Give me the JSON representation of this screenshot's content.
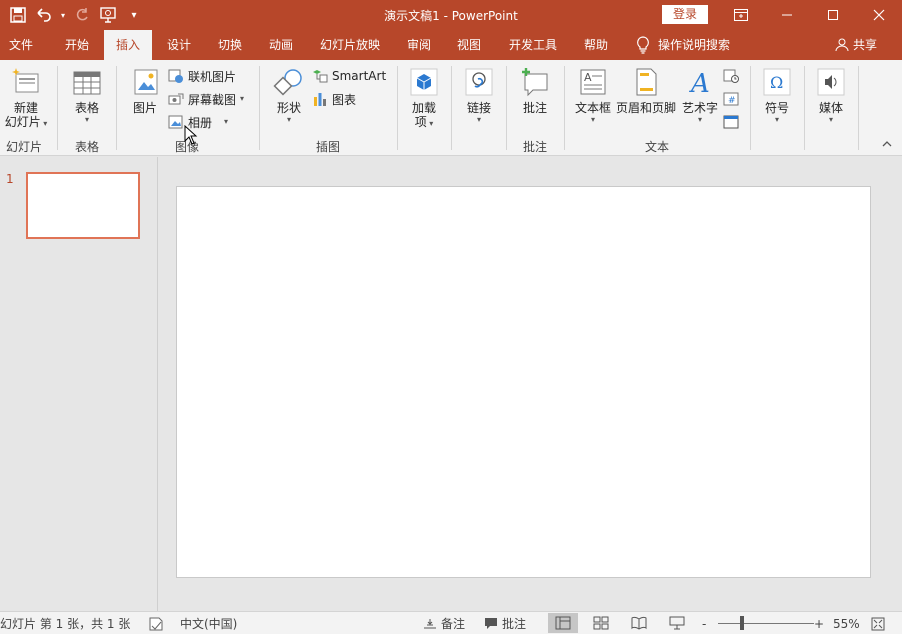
{
  "window": {
    "title": "演示文稿1  -  PowerPoint",
    "login_label": "登录",
    "minimize_icon": "—",
    "maximize_icon": "☐",
    "close_icon": "✕",
    "ribbon_display_icon": "▭"
  },
  "qat": {
    "save_icon": "save-icon",
    "undo_icon": "undo-icon",
    "redo_icon": "redo-icon",
    "slideshow_icon": "present-icon",
    "customize_icon": "customize-icon"
  },
  "tabs": [
    {
      "label": "文件"
    },
    {
      "label": "开始"
    },
    {
      "label": "插入"
    },
    {
      "label": "设计"
    },
    {
      "label": "切换"
    },
    {
      "label": "动画"
    },
    {
      "label": "幻灯片放映"
    },
    {
      "label": "审阅"
    },
    {
      "label": "视图"
    },
    {
      "label": "开发工具"
    },
    {
      "label": "帮助"
    }
  ],
  "active_tab": "插入",
  "tell_me": "操作说明搜索",
  "share": "共享",
  "ribbon": {
    "new_slide": {
      "line1": "新建",
      "line2": "幻灯片"
    },
    "table": "表格",
    "pictures": "图片",
    "online_pictures": "联机图片",
    "screenshot": "屏幕截图",
    "photo_album": "相册",
    "shapes": "形状",
    "smartart": "SmartArt",
    "chart": "图表",
    "addins": {
      "line1": "加载",
      "line2": "项"
    },
    "links": "链接",
    "comment": "批注",
    "textbox": "文本框",
    "header_footer": "页眉和页脚",
    "wordart": "艺术字",
    "symbols": "符号",
    "media": "媒体",
    "groups": {
      "slides": "幻灯片",
      "tables": "表格",
      "images": "图像",
      "illustrations": "插图",
      "comments": "批注",
      "text": "文本"
    }
  },
  "thumbnails": [
    {
      "number": "1"
    }
  ],
  "status": {
    "slide_info": "幻灯片 第 1 张，共 1 张",
    "language": "中文(中国)",
    "notes": "备注",
    "comments": "批注",
    "zoom_minus": "-",
    "zoom_plus": "+",
    "zoom": "55%",
    "zoom_fraction": 0.55
  },
  "colors": {
    "accent": "#b7472a",
    "ribbon": "#f3f3f3",
    "workspace": "#e6e6e6",
    "thumb_border": "#e07456"
  }
}
